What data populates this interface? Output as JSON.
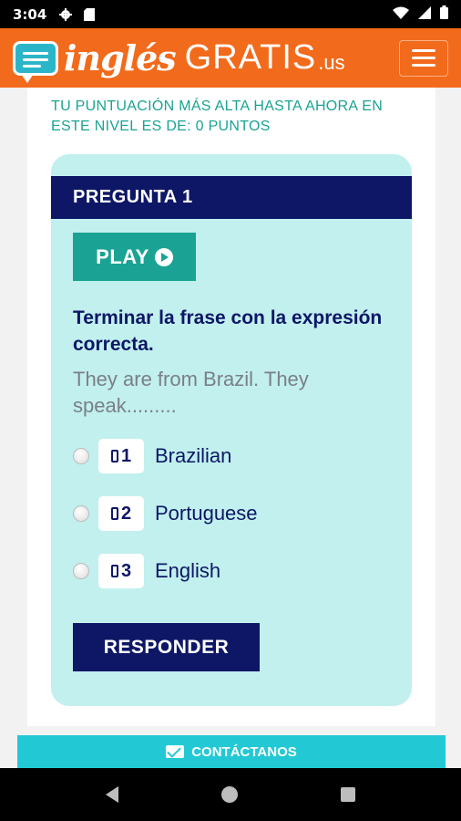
{
  "status_bar": {
    "time": "3:04",
    "icons_left": [
      "settings-icon",
      "sim-card-icon"
    ],
    "icons_right": [
      "wifi-icon",
      "signal-icon",
      "battery-icon"
    ]
  },
  "header": {
    "logo_script": "inglés",
    "logo_brand": "GRATIS",
    "logo_domain": ".us",
    "menu_icon": "hamburger-menu-icon"
  },
  "score_text": "TU PUNTUACIÓN MÁS ALTA HASTA AHORA EN ESTE NIVEL ES DE: 0 PUNTOS",
  "quiz": {
    "question_title": "PREGUNTA 1",
    "play_label": "PLAY",
    "instruction": "Terminar la frase con la expresión correcta.",
    "sentence": "They are from Brazil. They speak.........",
    "options": [
      {
        "key": "1",
        "text": "Brazilian"
      },
      {
        "key": "2",
        "text": "Portuguese"
      },
      {
        "key": "3",
        "text": "English"
      }
    ],
    "submit_label": "RESPONDER"
  },
  "contact_label": "CONTÁCTANOS",
  "colors": {
    "header": "#f26a1b",
    "navy": "#0e1766",
    "teal": "#1aa394",
    "quiz_bg": "#c1f0ee",
    "contact": "#22c9d4"
  }
}
